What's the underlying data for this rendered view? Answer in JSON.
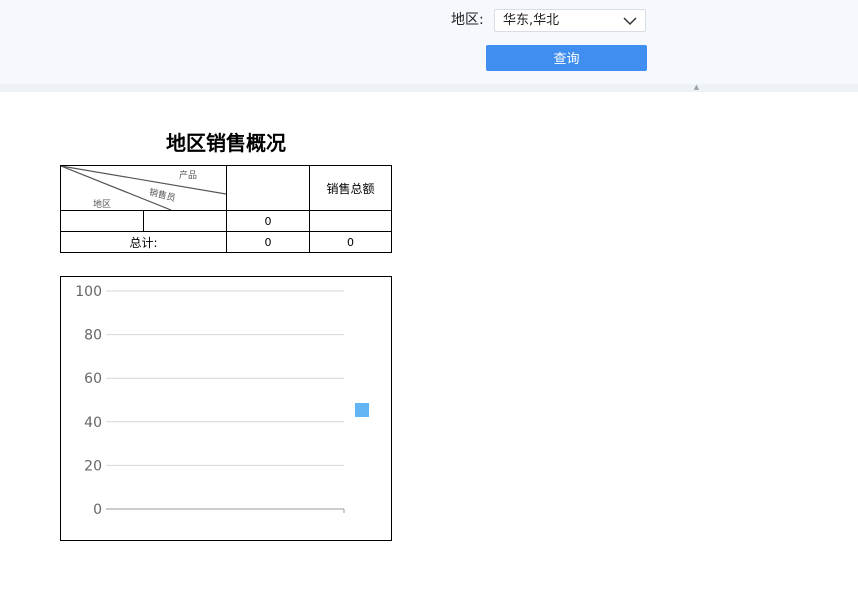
{
  "filter": {
    "region_label": "地区:",
    "region_value": "华东,华北",
    "query_button": "查询"
  },
  "report": {
    "title": "地区销售概况",
    "table": {
      "corner_labels": {
        "product": "产品",
        "salesperson": "销售员",
        "region": "地区"
      },
      "header_total": "销售总额",
      "row1": {
        "region": "",
        "salesperson": "",
        "amount": "0",
        "total": ""
      },
      "total_row": {
        "label": "总计:",
        "amount": "0",
        "total": "0"
      }
    }
  },
  "colors": {
    "accent": "#3f8ef0",
    "legend_swatch": "#64b5f6"
  },
  "chart_data": {
    "type": "bar",
    "categories": [],
    "series": [
      {
        "values": []
      }
    ],
    "ylim": [
      0,
      100
    ],
    "yticks": [
      0,
      20,
      40,
      60,
      80,
      100
    ],
    "grid": true,
    "legend": "right"
  }
}
